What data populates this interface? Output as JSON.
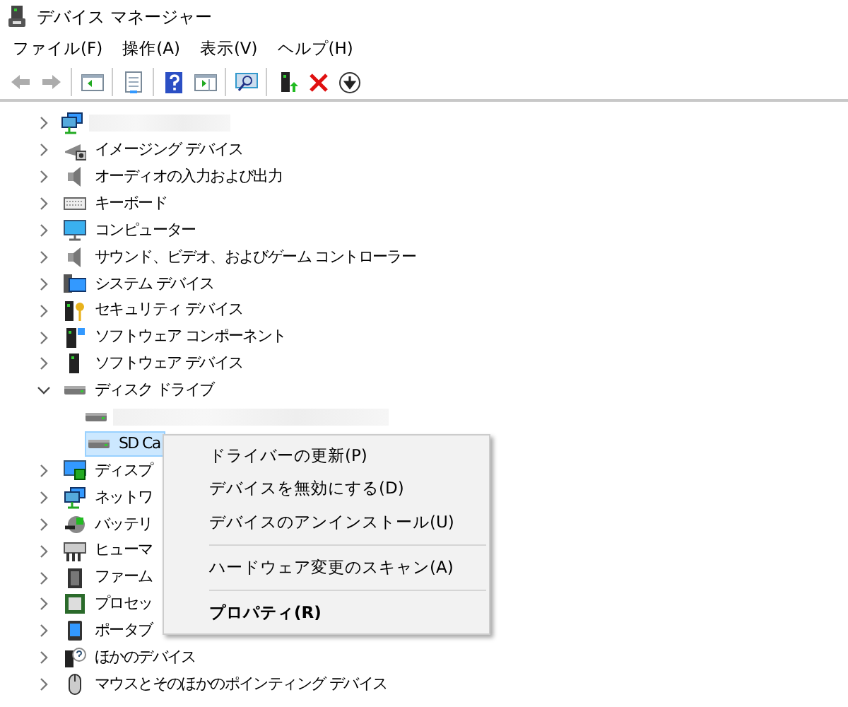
{
  "window": {
    "title": "デバイス マネージャー"
  },
  "menu_bar": [
    "ファイル(F)",
    "操作(A)",
    "表示(V)",
    "ヘルプ(H)"
  ],
  "toolbar": [
    {
      "disabled": true
    },
    {
      "disabled": true
    },
    {
      "disabled": false
    },
    {
      "disabled": false
    },
    {
      "disabled": false
    },
    {
      "disabled": false
    },
    {
      "disabled": false
    },
    {
      "disabled": false
    },
    {
      "disabled": false
    },
    {
      "disabled": false
    }
  ],
  "tree": [
    {
      "redacted": true,
      "expanded": false
    },
    {
      "label": "イメージング デバイス",
      "expanded": false,
      "selected": false
    },
    {
      "label": "オーディオの入力および出力",
      "expanded": false,
      "selected": false
    },
    {
      "label": "キーボード",
      "expanded": false,
      "selected": false
    },
    {
      "label": "コンピューター",
      "expanded": false,
      "selected": false
    },
    {
      "label": "サウンド、ビデオ、およびゲーム コントローラー",
      "expanded": false,
      "selected": false
    },
    {
      "label": "システム デバイス",
      "expanded": false,
      "selected": false
    },
    {
      "label": "セキュリティ デバイス",
      "expanded": false,
      "selected": false
    },
    {
      "label": "ソフトウェア コンポーネント",
      "expanded": false,
      "selected": false
    },
    {
      "label": "ソフトウェア デバイス",
      "expanded": false,
      "selected": false
    },
    {
      "label": "ディスク ドライブ",
      "expanded": true,
      "selected": false,
      "children": [
        {
          "redacted": true
        },
        {
          "label": "SD Ca",
          "selected": true
        }
      ]
    },
    {
      "label": "ディスプ",
      "expanded": false,
      "selected": false
    },
    {
      "label": "ネットワ",
      "expanded": false,
      "selected": false
    },
    {
      "label": "バッテリ",
      "expanded": false,
      "selected": false
    },
    {
      "label": "ヒューマ",
      "expanded": false,
      "selected": false
    },
    {
      "label": "ファーム",
      "expanded": false,
      "selected": false
    },
    {
      "label": "プロセッ",
      "expanded": false,
      "selected": false
    },
    {
      "label": "ポータブ",
      "expanded": false,
      "selected": false
    },
    {
      "label": "ほかのデバイス",
      "expanded": false,
      "selected": false
    },
    {
      "label": "マウスとそのほかのポインティング デバイス",
      "expanded": false,
      "selected": false
    }
  ],
  "context_menu": [
    {
      "kind": "item",
      "label": "ドライバーの更新(P)",
      "bold": false
    },
    {
      "kind": "item",
      "label": "デバイスを無効にする(D)",
      "bold": false
    },
    {
      "kind": "item",
      "label": "デバイスのアンインストール(U)",
      "bold": false
    },
    {
      "kind": "separator"
    },
    {
      "kind": "item",
      "label": "ハードウェア変更のスキャン(A)",
      "bold": false
    },
    {
      "kind": "separator"
    },
    {
      "kind": "item",
      "label": "プロパティ(R)",
      "bold": true
    }
  ]
}
